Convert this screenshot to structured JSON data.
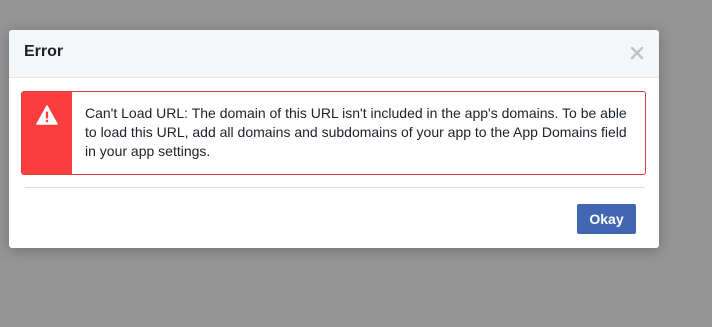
{
  "dialog": {
    "title": "Error",
    "close_icon": "close-icon",
    "error": {
      "icon": "warning-icon",
      "message": "Can't Load URL: The domain of this URL isn't included in the app's domains. To be able to load this URL, add all domains and subdomains of your app to the App Domains field in your app settings."
    },
    "okay_label": "Okay"
  },
  "colors": {
    "backdrop": "#959595",
    "header_bg": "#f5f6f7",
    "error_red": "#fa3e3e",
    "error_border": "#e0393e",
    "button_blue": "#4267b2",
    "close_gray": "#bec3c9"
  }
}
